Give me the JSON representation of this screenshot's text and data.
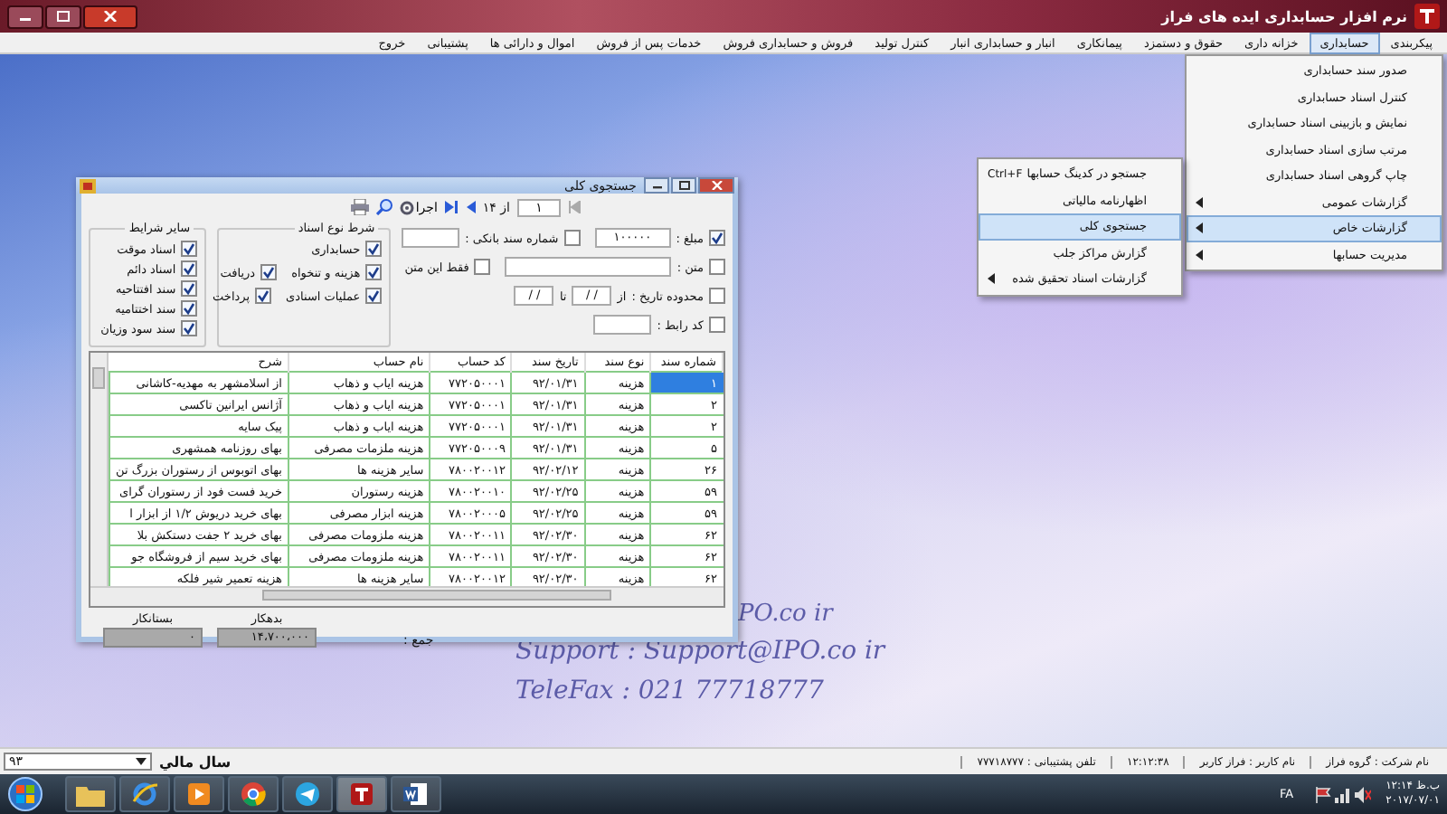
{
  "window": {
    "title": "نرم افزار حسابداری ایده های فراز"
  },
  "menu_bar": [
    {
      "label": "پیکربندی",
      "selected": false
    },
    {
      "label": "حسابداری",
      "selected": true
    },
    {
      "label": "خزانه داری",
      "selected": false
    },
    {
      "label": "حقوق و دستمزد",
      "selected": false
    },
    {
      "label": "پیمانکاری",
      "selected": false
    },
    {
      "label": "انبار و حسابداری انبار",
      "selected": false
    },
    {
      "label": "کنترل تولید",
      "selected": false
    },
    {
      "label": "فروش و حسابداری فروش",
      "selected": false
    },
    {
      "label": "خدمات پس از فروش",
      "selected": false
    },
    {
      "label": "اموال و دارائی ها",
      "selected": false
    },
    {
      "label": "پشتیبانی",
      "selected": false
    },
    {
      "label": "خروج",
      "selected": false
    }
  ],
  "dropdown": [
    {
      "label": "صدور سند حسابداری",
      "selected": false,
      "has_submenu": false
    },
    {
      "label": "کنترل اسناد حسابداری",
      "selected": false,
      "has_submenu": false
    },
    {
      "label": "نمایش و بازبینی اسناد حسابداری",
      "selected": false,
      "has_submenu": false
    },
    {
      "label": "مرتب سازی اسناد حسابداری",
      "selected": false,
      "has_submenu": false
    },
    {
      "label": "چاپ گروهی اسناد حسابداری",
      "selected": false,
      "has_submenu": false
    },
    {
      "label": "گزارشات عمومی",
      "selected": false,
      "has_submenu": true
    },
    {
      "label": "گزارشات خاص",
      "selected": true,
      "has_submenu": true
    },
    {
      "label": "مدیریت حسابها",
      "selected": false,
      "has_submenu": true
    }
  ],
  "submenu": [
    {
      "label": "جستجو در کدینگ حسابها",
      "shortcut": "Ctrl+F",
      "selected": false,
      "has_submenu": false
    },
    {
      "label": "اظهارنامه مالیاتی",
      "selected": false,
      "has_submenu": false
    },
    {
      "label": "جستجوی کلی",
      "selected": true,
      "has_submenu": false
    },
    {
      "label": "گزارش مراکز جلب",
      "selected": false,
      "has_submenu": false
    },
    {
      "label": "گزارشات اسناد تحقیق شده",
      "selected": false,
      "has_submenu": true
    }
  ],
  "dialog": {
    "title": "جستجوی کلی",
    "pager": {
      "page": "۱",
      "of": "از ۱۴"
    },
    "run_button": "اجرا",
    "filter_rows": [
      [
        {
          "kind": "field",
          "label": "مبلغ :",
          "checked": true,
          "value": "۱۰۰۰۰۰"
        },
        {
          "kind": "field",
          "label": "شماره سند بانکی :",
          "checked": false
        }
      ],
      [
        {
          "kind": "field",
          "label": "متن :",
          "checked": false
        },
        {
          "kind": "check",
          "label": "فقط این متن",
          "checked": false
        }
      ],
      [
        {
          "kind": "range",
          "label": "محدوده تاریخ :",
          "checked": false,
          "from_label": "از",
          "to_label": "تا",
          "from": "/ /",
          "to": "/ /"
        }
      ],
      [
        {
          "kind": "field",
          "label": "کد رابط :",
          "checked": false
        }
      ]
    ],
    "groups": [
      {
        "title": "شرط نوع اسناد",
        "rows": [
          [
            {
              "label": "حسابداری",
              "checked": true
            }
          ],
          [
            {
              "label": "هزینه و تنخواه",
              "checked": true
            },
            {
              "label": "دریافت",
              "checked": true
            }
          ],
          [
            {
              "label": "عملیات اسنادی",
              "checked": true
            },
            {
              "label": "پرداخت",
              "checked": true
            }
          ]
        ]
      },
      {
        "title": "سایر شرایط",
        "rows": [
          [
            {
              "label": "اسناد موقت",
              "checked": true
            }
          ],
          [
            {
              "label": "اسناد دائم",
              "checked": true
            }
          ],
          [
            {
              "label": "سند افتتاحیه",
              "checked": true
            }
          ],
          [
            {
              "label": "سند اختتامیه",
              "checked": true
            }
          ],
          [
            {
              "label": "سند سود وزیان",
              "checked": true
            }
          ]
        ]
      }
    ],
    "table": {
      "columns": [
        "شماره سند",
        "نوع سند",
        "تاریخ سند",
        "کد حساب",
        "نام حساب",
        "شرح"
      ],
      "rows": [
        {
          "selected": true,
          "cells": [
            "۱",
            "هزینه",
            "۹۲/۰۱/۳۱",
            "۷۷۲۰۵۰۰۰۱",
            "هزینه ایاب و ذهاب",
            "از اسلامشهر به مهدیه-کاشانی"
          ]
        },
        {
          "selected": false,
          "cells": [
            "۲",
            "هزینه",
            "۹۲/۰۱/۳۱",
            "۷۷۲۰۵۰۰۰۱",
            "هزینه ایاب و ذهاب",
            "آژانس ایرانین تاکسی"
          ]
        },
        {
          "selected": false,
          "cells": [
            "۲",
            "هزینه",
            "۹۲/۰۱/۳۱",
            "۷۷۲۰۵۰۰۰۱",
            "هزینه ایاب و ذهاب",
            "پیک سایه"
          ]
        },
        {
          "selected": false,
          "cells": [
            "۵",
            "هزینه",
            "۹۲/۰۱/۳۱",
            "۷۷۲۰۵۰۰۰۹",
            "هزینه ملزمات مصرفی",
            "بهای روزنامه همشهری"
          ]
        },
        {
          "selected": false,
          "cells": [
            "۲۶",
            "هزینه",
            "۹۲/۰۲/۱۲",
            "۷۸۰۰۲۰۰۱۲",
            "سایر هزینه ها",
            "بهای اتوبوس از رستوران بزرگ تن"
          ]
        },
        {
          "selected": false,
          "cells": [
            "۵۹",
            "هزینه",
            "۹۲/۰۲/۲۵",
            "۷۸۰۰۲۰۰۱۰",
            "هزینه رستوران",
            "خرید فست فود از رستوران گرای"
          ]
        },
        {
          "selected": false,
          "cells": [
            "۵۹",
            "هزینه",
            "۹۲/۰۲/۲۵",
            "۷۸۰۰۲۰۰۰۵",
            "هزینه ابزار مصرفی",
            "بهای خرید دریوش ۱/۲ از ابزار ا"
          ]
        },
        {
          "selected": false,
          "cells": [
            "۶۲",
            "هزینه",
            "۹۲/۰۲/۳۰",
            "۷۸۰۰۲۰۰۱۱",
            "هزینه ملزومات مصرفی",
            "بهای خرید ۲ جفت دستکش بلا"
          ]
        },
        {
          "selected": false,
          "cells": [
            "۶۲",
            "هزینه",
            "۹۲/۰۲/۳۰",
            "۷۸۰۰۲۰۰۱۱",
            "هزینه ملزومات مصرفی",
            "بهای خرید سیم از فروشگاه جو"
          ]
        },
        {
          "selected": false,
          "cells": [
            "۶۲",
            "هزینه",
            "۹۲/۰۲/۳۰",
            "۷۸۰۰۲۰۰۱۲",
            "سایر هزینه ها",
            "هزینه تعمیر شیر فلکه"
          ]
        }
      ]
    },
    "totals": {
      "label": "جمع :",
      "debit_label": "بدهکار",
      "debit": "۱۴،۷۰۰،۰۰۰",
      "credit_label": "بستانکار",
      "credit": "۰"
    }
  },
  "background_text": {
    "partial": "PO.co ir",
    "support": "Support : Support@IPO.co ir",
    "telefax": "TeleFax : 021 77718777"
  },
  "status_bar": {
    "year_value": "۹۳",
    "year_label": "سال مالي",
    "items": [
      "نام شرکت : گروه فراز",
      "نام کاربر : فراز کاربر",
      "۱۲:۱۲:۳۸",
      "تلفن پشتیبانی : ۷۷۷۱۸۷۷۷"
    ]
  },
  "taskbar": {
    "language": "FA",
    "time": "۱۲:۱۴ ب.ظ",
    "date": "۲۰۱۷/۰۷/۰۱"
  }
}
